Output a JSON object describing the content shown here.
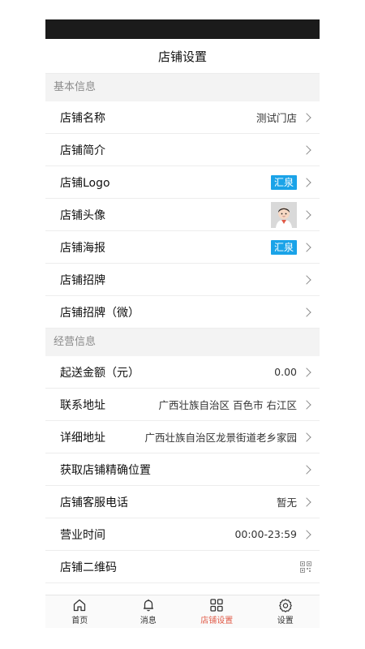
{
  "header": {
    "title": "店铺设置"
  },
  "sections": {
    "basic": {
      "title": "基本信息",
      "rows": [
        {
          "label": "店铺名称",
          "value": "测试门店"
        },
        {
          "label": "店铺简介",
          "value": ""
        },
        {
          "label": "店铺Logo",
          "badge": "汇泉"
        },
        {
          "label": "店铺头像"
        },
        {
          "label": "店铺海报",
          "badge": "汇泉"
        },
        {
          "label": "店铺招牌",
          "value": ""
        },
        {
          "label": "店铺招牌（微）",
          "value": ""
        }
      ]
    },
    "business": {
      "title": "经营信息",
      "rows": [
        {
          "label": "起送金额（元）",
          "value": "0.00"
        },
        {
          "label": "联系地址",
          "value": "广西壮族自治区 百色市 右江区"
        },
        {
          "label": "详细地址",
          "value": "广西壮族自治区龙景街道老乡家园"
        },
        {
          "label": "获取店铺精确位置",
          "value": ""
        },
        {
          "label": "店铺客服电话",
          "value": "暂无"
        },
        {
          "label": "营业时间",
          "value": "00:00-23:59"
        },
        {
          "label": "店铺二维码"
        }
      ]
    }
  },
  "tabbar": {
    "items": [
      {
        "label": "首页",
        "icon": "home-icon"
      },
      {
        "label": "消息",
        "icon": "bell-icon"
      },
      {
        "label": "店铺设置",
        "icon": "store-grid-icon",
        "active": true
      },
      {
        "label": "设置",
        "icon": "gear-icon"
      }
    ],
    "active_color": "#e05a47"
  },
  "colors": {
    "badge": "#1aa3e8",
    "section_bg": "#f3f3f3"
  }
}
